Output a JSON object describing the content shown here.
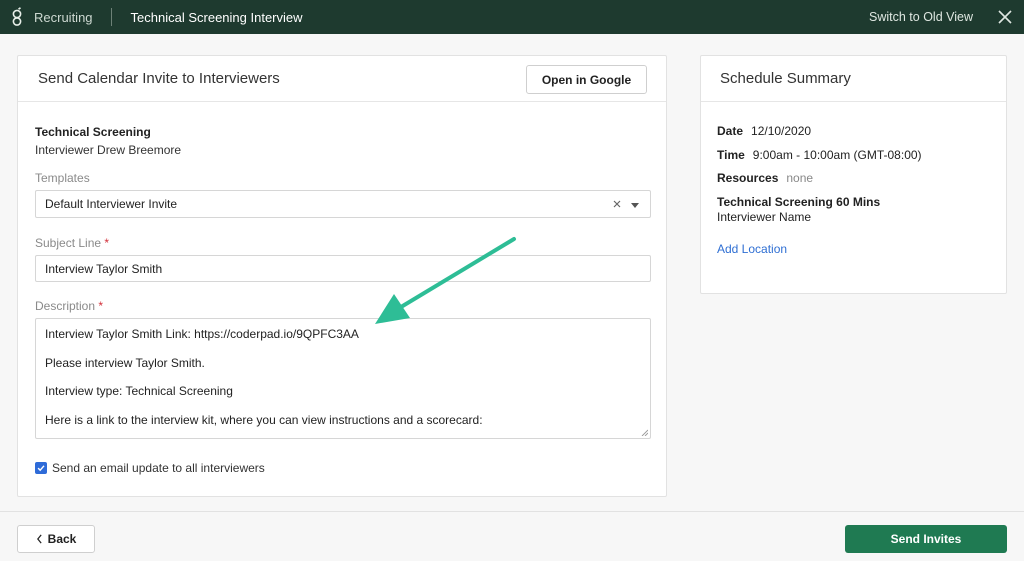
{
  "topbar": {
    "app_name": "Recruiting",
    "page_title": "Technical Screening Interview",
    "switch_label": "Switch to Old View"
  },
  "invite_panel": {
    "title": "Send Calendar Invite to Interviewers",
    "open_google_label": "Open in Google",
    "interview_name": "Technical Screening",
    "interviewer": "Interviewer Drew Breemore",
    "templates_label": "Templates",
    "template_value": "Default Interviewer Invite",
    "subject_label": "Subject Line",
    "subject_required": "*",
    "subject_value": "Interview Taylor Smith",
    "description_label": "Description",
    "description_required": "*",
    "description_lines": [
      "Interview Taylor Smith Link: https://coderpad.io/9QPFC3AA",
      "Please interview Taylor Smith.",
      "Interview type: Technical Screening",
      "Here is a link to the interview kit, where you can view instructions and a scorecard:"
    ],
    "email_update_label": "Send an email update to all interviewers",
    "email_update_checked": true
  },
  "summary_panel": {
    "title": "Schedule Summary",
    "date_label": "Date",
    "date_value": "12/10/2020",
    "time_label": "Time",
    "time_value": "9:00am - 10:00am (GMT-08:00)",
    "resources_label": "Resources",
    "resources_value": "none",
    "session_title": "Technical Screening 60 Mins",
    "session_interviewer": "Interviewer Name",
    "add_location_label": "Add Location"
  },
  "footer": {
    "back_label": "Back",
    "send_label": "Send Invites"
  },
  "colors": {
    "topbar_bg": "#1e3a2f",
    "primary_button": "#1f7a52",
    "link": "#2f6fd3",
    "annotation_arrow": "#2ebd96",
    "checkbox": "#2e6bd8"
  },
  "icons": {
    "logo": "greenhouse-logo-icon",
    "close": "close-icon",
    "clear": "clear-icon",
    "caret": "caret-down-icon",
    "back": "chevron-left-icon",
    "check": "checkmark-icon",
    "annotation": "annotation-arrow-icon"
  }
}
